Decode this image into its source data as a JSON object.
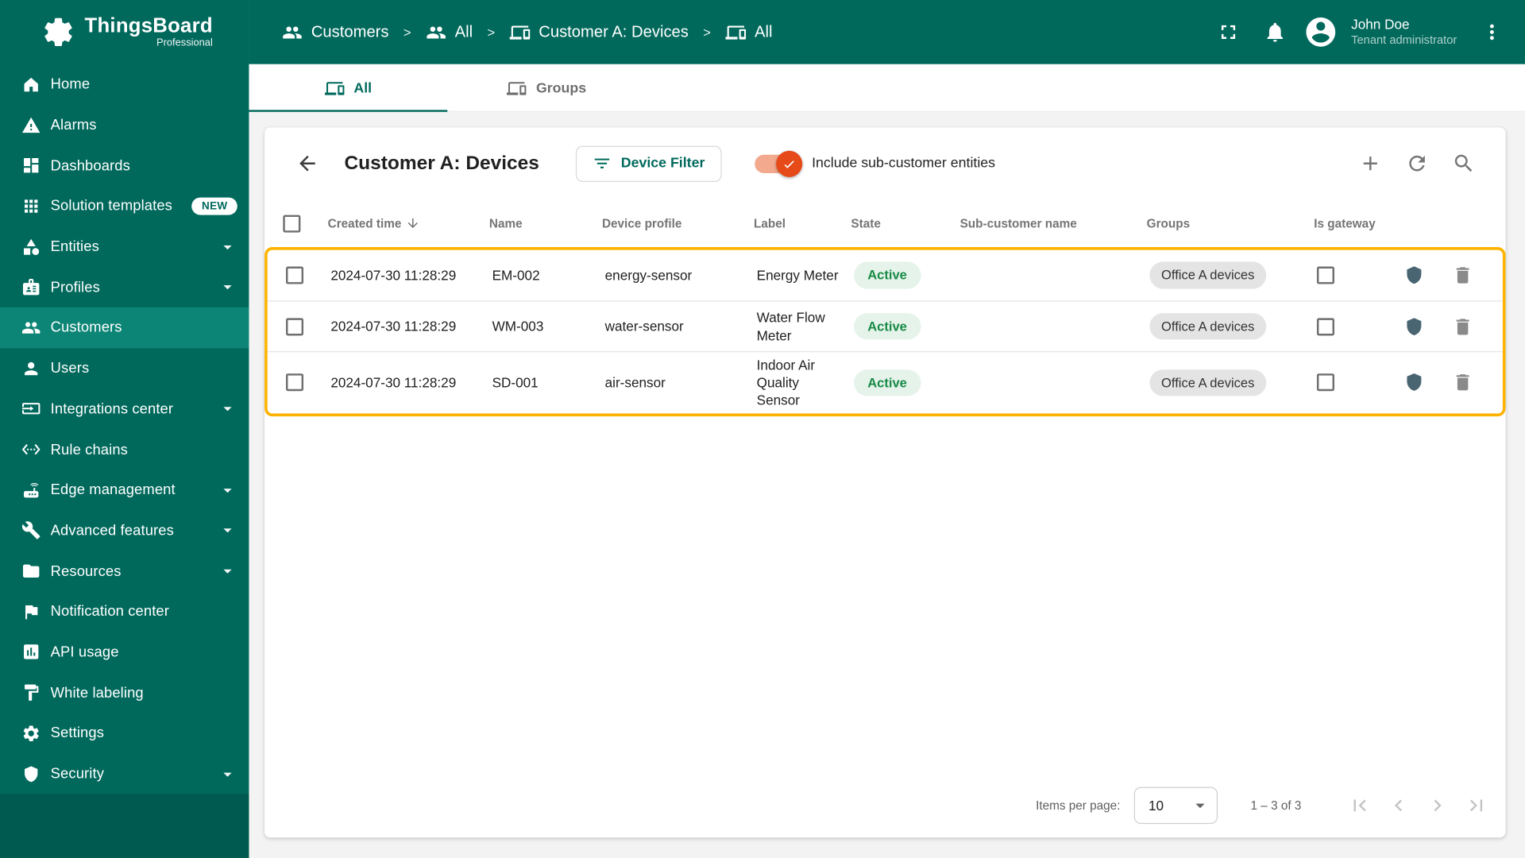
{
  "app": {
    "name": "ThingsBoard",
    "subtitle": "Professional"
  },
  "sidebar": {
    "items": [
      {
        "label": "Home"
      },
      {
        "label": "Alarms"
      },
      {
        "label": "Dashboards"
      },
      {
        "label": "Solution templates",
        "badge": "NEW"
      },
      {
        "label": "Entities"
      },
      {
        "label": "Profiles"
      },
      {
        "label": "Customers"
      },
      {
        "label": "Users"
      },
      {
        "label": "Integrations center"
      },
      {
        "label": "Rule chains"
      },
      {
        "label": "Edge management"
      },
      {
        "label": "Advanced features"
      },
      {
        "label": "Resources"
      },
      {
        "label": "Notification center"
      },
      {
        "label": "API usage"
      },
      {
        "label": "White labeling"
      },
      {
        "label": "Settings"
      },
      {
        "label": "Security"
      }
    ]
  },
  "breadcrumbs": {
    "separator": ">",
    "items": [
      {
        "label": "Customers"
      },
      {
        "label": "All"
      },
      {
        "label": "Customer A: Devices"
      },
      {
        "label": "All"
      }
    ]
  },
  "user": {
    "name": "John Doe",
    "role": "Tenant administrator"
  },
  "tabs": {
    "all": "All",
    "groups": "Groups"
  },
  "toolbar": {
    "title": "Customer A: Devices",
    "device_filter": "Device Filter",
    "include_toggle_label": "Include sub-customer entities",
    "toggle_checked": true
  },
  "table": {
    "headers": {
      "created": "Created time",
      "name": "Name",
      "profile": "Device profile",
      "label": "Label",
      "state": "State",
      "sub_customer": "Sub-customer name",
      "groups": "Groups",
      "gateway": "Is gateway"
    },
    "rows": [
      {
        "created": "2024-07-30 11:28:29",
        "name": "EM-002",
        "profile": "energy-sensor",
        "label": "Energy Meter",
        "state": "Active",
        "sub_customer": "",
        "group": "Office A devices"
      },
      {
        "created": "2024-07-30 11:28:29",
        "name": "WM-003",
        "profile": "water-sensor",
        "label": "Water Flow Meter",
        "state": "Active",
        "sub_customer": "",
        "group": "Office A devices"
      },
      {
        "created": "2024-07-30 11:28:29",
        "name": "SD-001",
        "profile": "air-sensor",
        "label": "Indoor Air Quality Sensor",
        "state": "Active",
        "sub_customer": "",
        "group": "Office A devices"
      }
    ]
  },
  "pagination": {
    "items_per_page_label": "Items per page:",
    "page_size": "10",
    "range": "1 – 3 of 3"
  },
  "colors": {
    "sidebar_bg": "#00695c",
    "active_item_bg": "#0d8576",
    "accent": "#00695c",
    "highlight_border": "#ffb300",
    "toggle_on": "#e64a19",
    "state_active_bg": "#e5f3ea",
    "state_active_text": "#178a45",
    "group_chip_bg": "#e4e4e4"
  }
}
